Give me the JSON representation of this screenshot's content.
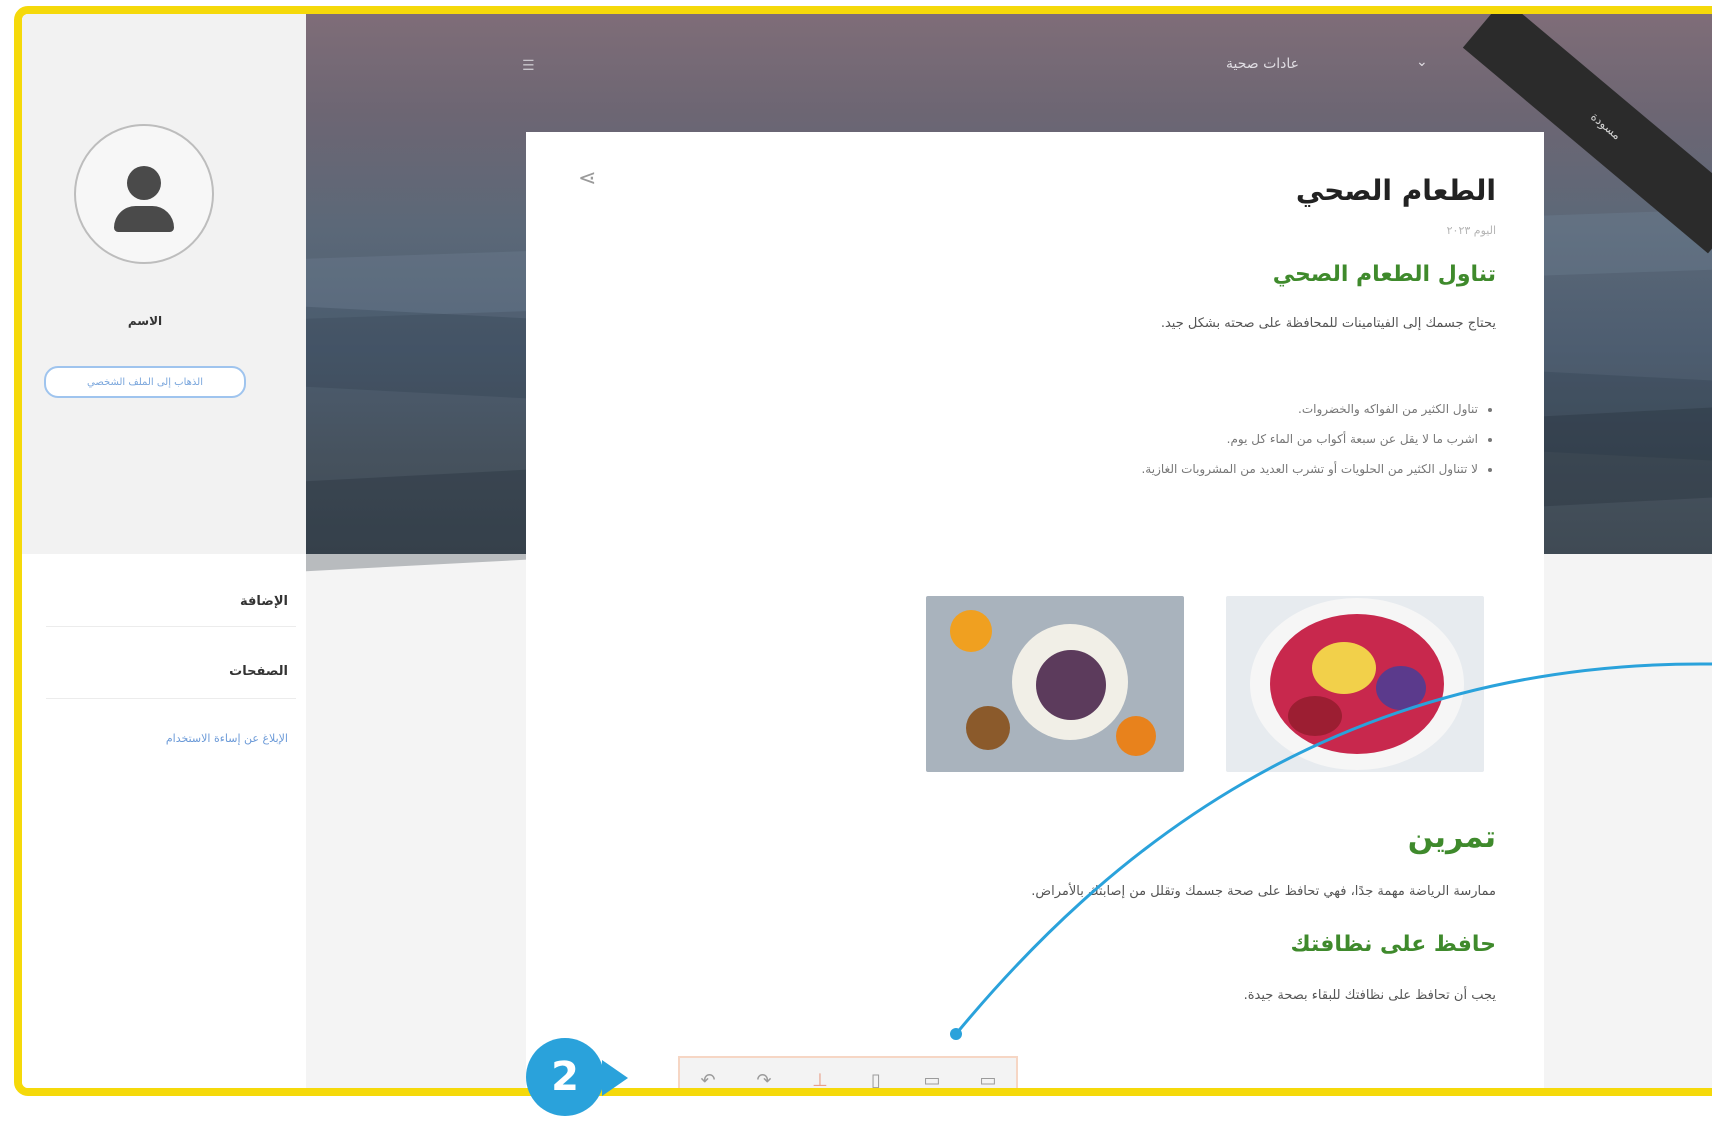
{
  "sidebar": {
    "user_name": "الاسم",
    "profile_button": "الذهاب إلى الملف الشخصي",
    "links": [
      "الإضافة",
      "الصفحات",
      "الإبلاغ عن إساءة الاستخدام"
    ]
  },
  "topbar": {
    "title": "عادات صحية",
    "ribbon": "مسودة"
  },
  "card": {
    "title": "الطعام الصحي",
    "meta": "اليوم ٢٠٢٣",
    "section1_heading": "تناول الطعام الصحي",
    "section1_text": "يحتاج جسمك إلى الفيتامينات للمحافظة على صحته بشكل جيد.",
    "list": [
      "تناول الكثير من الفواكه والخضروات.",
      "اشرب ما لا يقل عن سبعة أكواب من الماء كل يوم.",
      "لا تتناول الكثير من الحلويات أو تشرب العديد من المشروبات الغازية."
    ],
    "section2_heading": "تمرين",
    "section2_text": "ممارسة الرياضة مهمة جدًا، فهي تحافظ على صحة جسمك وتقلل من إصابتك بالأمراض.",
    "section3_heading": "حافظ على نظافتك",
    "section3_text": "يجب أن تحافظ على نظافتك للبقاء بصحة جيدة."
  },
  "toolbar": {
    "icons": [
      "undo-icon",
      "redo-icon",
      "pin-icon",
      "phone-icon",
      "tablet-icon",
      "desktop-icon"
    ],
    "glyphs": [
      "↶",
      "↷",
      "⊥",
      "▯",
      "▭",
      "▭"
    ]
  },
  "callout": {
    "number": "2",
    "color": "#2aa2db"
  }
}
